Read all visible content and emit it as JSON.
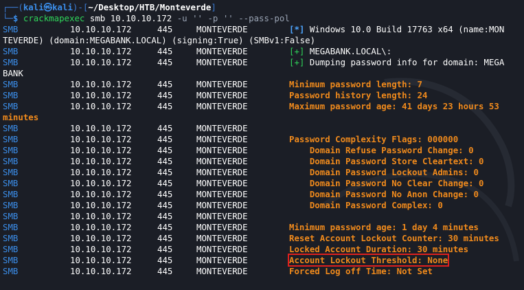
{
  "prompt": {
    "corner_top": "┌──(",
    "user": "kali㉿kali",
    "sep": ")-[",
    "path": "~/Desktop/HTB/Monteverde",
    "close": "]",
    "corner_bottom": "└─",
    "dollar": "$",
    "command": "crackmapexec",
    "args": "smb 10.10.10.172",
    "flags": "-u '' -p '' --pass-pol"
  },
  "colors": {
    "background": "#1b1e26",
    "protocol": "#3b8eea",
    "success": "#2fd65a",
    "highlight_text": "#f08a1c",
    "highlight_box": "#e0201e"
  },
  "rows": [
    {
      "proto": "SMB",
      "ip": "10.10.10.172",
      "port": "445",
      "host": "MONTEVERDE",
      "tag": "[*]",
      "tag_color": "blue",
      "msg": "Windows 10.0 Build 17763 x64 (name:MON",
      "msg_color": "white"
    },
    {
      "wrap": "TEVERDE) (domain:MEGABANK.LOCAL) (signing:True) (SMBv1:False)",
      "wrap_color": "white"
    },
    {
      "proto": "SMB",
      "ip": "10.10.10.172",
      "port": "445",
      "host": "MONTEVERDE",
      "tag": "[+]",
      "tag_color": "green",
      "msg": "MEGABANK.LOCAL\\:",
      "msg_color": "white"
    },
    {
      "proto": "SMB",
      "ip": "10.10.10.172",
      "port": "445",
      "host": "MONTEVERDE",
      "tag": "[+]",
      "tag_color": "green",
      "msg": "Dumping password info for domain: MEGA",
      "msg_color": "white"
    },
    {
      "wrap": "BANK",
      "wrap_color": "white"
    },
    {
      "proto": "SMB",
      "ip": "10.10.10.172",
      "port": "445",
      "host": "MONTEVERDE",
      "msg": "Minimum password length: 7",
      "msg_color": "orange"
    },
    {
      "proto": "SMB",
      "ip": "10.10.10.172",
      "port": "445",
      "host": "MONTEVERDE",
      "msg": "Password history length: 24",
      "msg_color": "orange"
    },
    {
      "proto": "SMB",
      "ip": "10.10.10.172",
      "port": "445",
      "host": "MONTEVERDE",
      "msg": "Maximum password age: 41 days 23 hours 53",
      "msg_color": "orange"
    },
    {
      "wrap": "minutes",
      "wrap_color": "orange"
    },
    {
      "proto": "SMB",
      "ip": "10.10.10.172",
      "port": "445",
      "host": "MONTEVERDE",
      "msg": ""
    },
    {
      "proto": "SMB",
      "ip": "10.10.10.172",
      "port": "445",
      "host": "MONTEVERDE",
      "msg": "Password Complexity Flags: 000000",
      "msg_color": "orange"
    },
    {
      "proto": "SMB",
      "ip": "10.10.10.172",
      "port": "445",
      "host": "MONTEVERDE",
      "msg": "    Domain Refuse Password Change: 0",
      "msg_color": "orange"
    },
    {
      "proto": "SMB",
      "ip": "10.10.10.172",
      "port": "445",
      "host": "MONTEVERDE",
      "msg": "    Domain Password Store Cleartext: 0",
      "msg_color": "orange"
    },
    {
      "proto": "SMB",
      "ip": "10.10.10.172",
      "port": "445",
      "host": "MONTEVERDE",
      "msg": "    Domain Password Lockout Admins: 0",
      "msg_color": "orange"
    },
    {
      "proto": "SMB",
      "ip": "10.10.10.172",
      "port": "445",
      "host": "MONTEVERDE",
      "msg": "    Domain Password No Clear Change: 0",
      "msg_color": "orange"
    },
    {
      "proto": "SMB",
      "ip": "10.10.10.172",
      "port": "445",
      "host": "MONTEVERDE",
      "msg": "    Domain Password No Anon Change: 0",
      "msg_color": "orange"
    },
    {
      "proto": "SMB",
      "ip": "10.10.10.172",
      "port": "445",
      "host": "MONTEVERDE",
      "msg": "    Domain Password Complex: 0",
      "msg_color": "orange"
    },
    {
      "proto": "SMB",
      "ip": "10.10.10.172",
      "port": "445",
      "host": "MONTEVERDE",
      "msg": ""
    },
    {
      "proto": "SMB",
      "ip": "10.10.10.172",
      "port": "445",
      "host": "MONTEVERDE",
      "msg": "Minimum password age: 1 day 4 minutes",
      "msg_color": "orange"
    },
    {
      "proto": "SMB",
      "ip": "10.10.10.172",
      "port": "445",
      "host": "MONTEVERDE",
      "msg": "Reset Account Lockout Counter: 30 minutes",
      "msg_color": "orange"
    },
    {
      "proto": "SMB",
      "ip": "10.10.10.172",
      "port": "445",
      "host": "MONTEVERDE",
      "msg": "Locked Account Duration: 30 minutes",
      "msg_color": "orange"
    },
    {
      "proto": "SMB",
      "ip": "10.10.10.172",
      "port": "445",
      "host": "MONTEVERDE",
      "msg": "Account Lockout Threshold: None",
      "msg_color": "orange",
      "highlight": true
    },
    {
      "proto": "SMB",
      "ip": "10.10.10.172",
      "port": "445",
      "host": "MONTEVERDE",
      "msg": "Forced Log off Time: Not Set",
      "msg_color": "orange"
    }
  ]
}
